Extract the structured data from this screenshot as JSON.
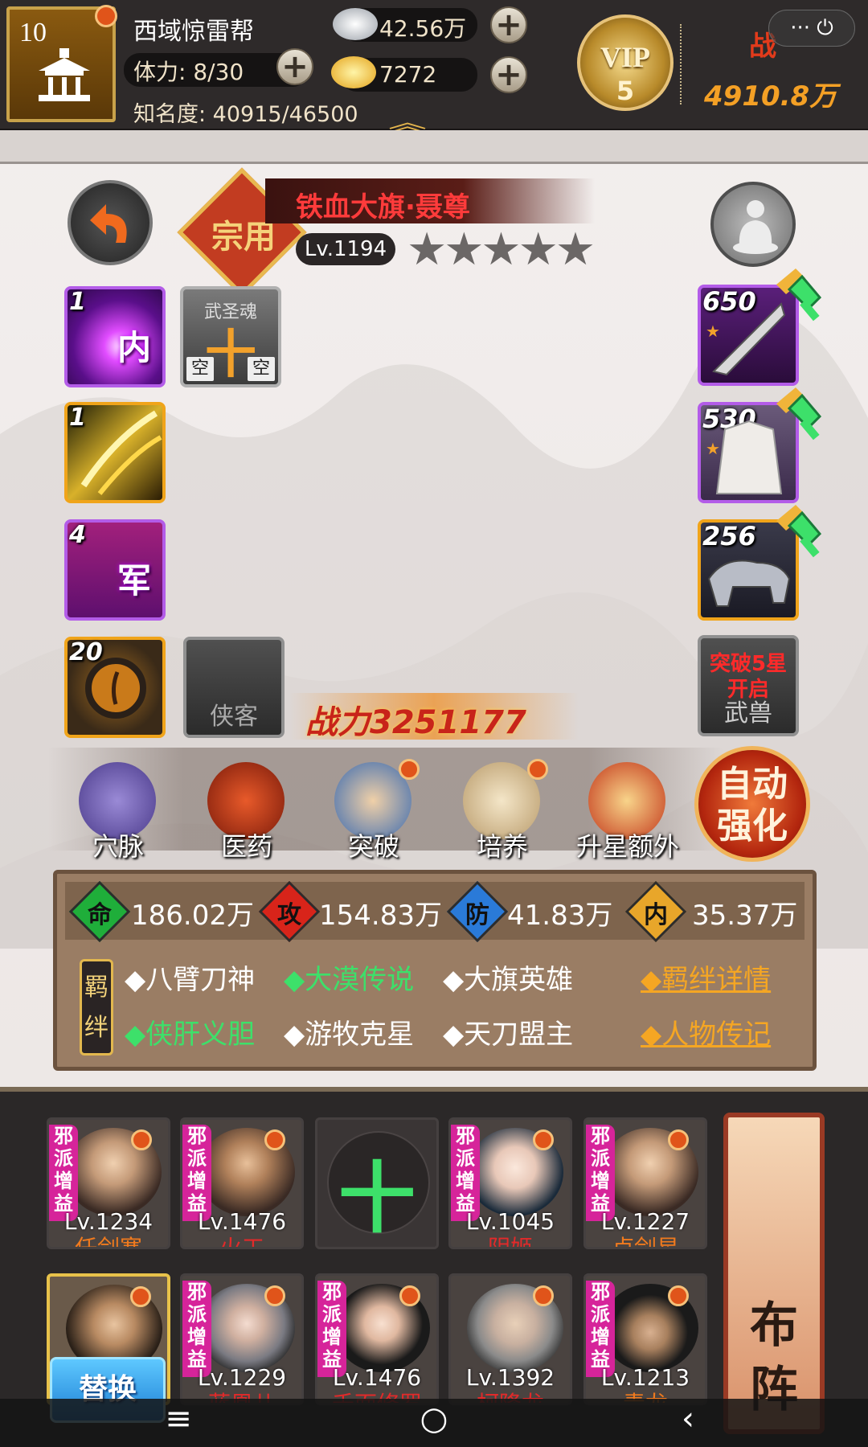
{
  "topbar": {
    "guild_level": "10",
    "guild_name": "西域惊雷帮",
    "stamina": "体力: 8/30",
    "fame": "知名度: 40915/46500",
    "silver": "42.56万",
    "gold": "7272",
    "vip_label": "VIP",
    "vip_level": "5",
    "power_label": "战",
    "power_value": "4910.8万",
    "capsule": "··· ⏻"
  },
  "hero": {
    "badge": "宗用",
    "name": "铁血大旗·聂尊",
    "level": "Lv.1194",
    "stars": "★★★★★"
  },
  "skills": [
    {
      "num": "1",
      "char": "内"
    },
    {
      "num": "1",
      "char": ""
    },
    {
      "num": "4",
      "char": "军"
    },
    {
      "num": "20",
      "char": ""
    }
  ],
  "soul_slot": {
    "title": "武圣魂",
    "plus": "十",
    "left": "空",
    "right": "空"
  },
  "xiake_slot": "侠客",
  "equipment": [
    {
      "num": "650"
    },
    {
      "num": "530"
    },
    {
      "num": "256"
    }
  ],
  "beast_slot": {
    "lock": "突破5星开启",
    "label": "武兽"
  },
  "combat_power": "战力3251177",
  "functions": [
    {
      "label": "穴脉"
    },
    {
      "label": "医药"
    },
    {
      "label": "突破"
    },
    {
      "label": "培养"
    },
    {
      "label": "升星额外"
    }
  ],
  "auto_strengthen": {
    "line1": "自动",
    "line2": "强化"
  },
  "stats": [
    {
      "icon": "命",
      "value": "186.02万"
    },
    {
      "icon": "攻",
      "value": "154.83万"
    },
    {
      "icon": "防",
      "value": "41.83万"
    },
    {
      "icon": "内",
      "value": "35.37万"
    }
  ],
  "bond_tag": "羁绊",
  "bonds": [
    {
      "text": "◆八臂刀神"
    },
    {
      "text": "◆大漠传说"
    },
    {
      "text": "◆大旗英雄"
    },
    {
      "text": "◆侠肝义胆"
    },
    {
      "text": "◆游牧克星"
    },
    {
      "text": "◆天刀盟主"
    }
  ],
  "links": {
    "bond_detail": "◆羁绊详情",
    "biography": "◆人物传记"
  },
  "team_row1": [
    {
      "tag": "邪派增益",
      "level": "Lv.1234",
      "name": "任剑寒"
    },
    {
      "tag": "邪派增益",
      "level": "Lv.1476",
      "name": "火工"
    },
    {
      "plus": "十"
    },
    {
      "tag": "邪派增益",
      "level": "Lv.1045",
      "name": "阴姬"
    },
    {
      "tag": "邪派增益",
      "level": "Lv.1227",
      "name": "卢剑星"
    }
  ],
  "team_row2": [
    {
      "tag": "",
      "level": "",
      "name": ""
    },
    {
      "tag": "邪派增益",
      "level": "Lv.1229",
      "name": "蓝凰儿"
    },
    {
      "tag": "邪派增益",
      "level": "Lv.1476",
      "name": "千面修罗"
    },
    {
      "tag": "",
      "level": "Lv.1392",
      "name": "柯降龙"
    },
    {
      "tag": "邪派增益",
      "level": "Lv.1213",
      "name": "青龙"
    }
  ],
  "swap_button": "替换",
  "formation": {
    "line1": "布",
    "line2": "阵"
  },
  "nav": {
    "menu": "≡",
    "home": "○",
    "back": "‹"
  }
}
